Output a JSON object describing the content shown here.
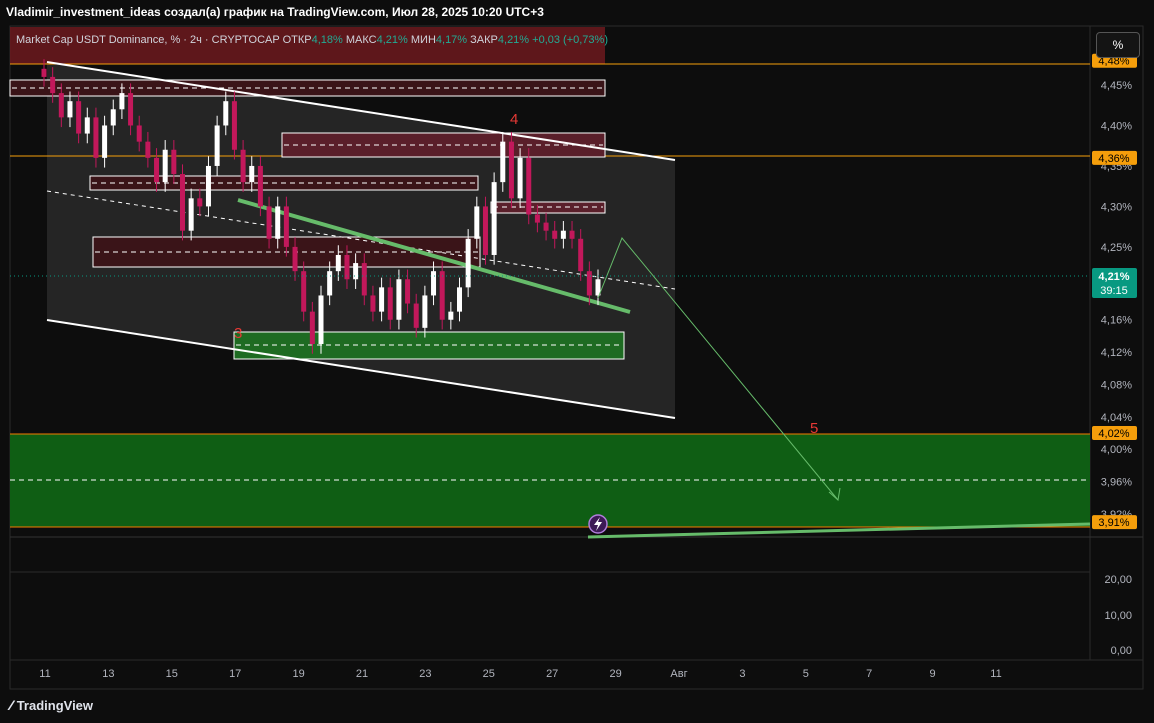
{
  "header": {
    "title": "Vladimir_investment_ideas создал(а) график на TradingView.com, Июл 28, 2025 10:20 UTC+3"
  },
  "legend": {
    "symbol": "Market Cap USDT Dominance, % · 2ч · CRYPTOCAP",
    "open_label": "ОТКР",
    "open": "4,18%",
    "high_label": "МАКС",
    "high": "4,21%",
    "low_label": "МИН",
    "low": "4,17%",
    "close_label": "ЗАКР",
    "close": "4,21%",
    "change": "+0,03 (+0,73%)"
  },
  "scale_button": "%",
  "footer": {
    "brand": "TradingView"
  },
  "colors": {
    "background": "#0d0d0d",
    "candle_up": "#ffffff",
    "candle_down": "#c2185b",
    "green_zone": "#0f5e14",
    "price_tag": "#f59e0b",
    "last_price_tag": "#089981",
    "trend_green": "#66bb6a"
  },
  "chart_data": {
    "type": "line",
    "price_axis": {
      "ticks": [
        "4,45%",
        "4,40%",
        "4,35%",
        "4,30%",
        "4,25%",
        "4,16%",
        "4,12%",
        "4,08%",
        "4,04%",
        "4,00%",
        "3,96%",
        "3,92%"
      ],
      "price_tags": [
        "4,48%",
        "4,36%",
        "4,02%",
        "3,91%"
      ],
      "last_price": "4,21%",
      "countdown": "39:15"
    },
    "lower_axis": {
      "ticks": [
        "20,00",
        "10,00",
        "0,00"
      ]
    },
    "time_axis": {
      "ticks": [
        "11",
        "13",
        "15",
        "17",
        "19",
        "21",
        "23",
        "25",
        "27",
        "29",
        "Авг",
        "3",
        "5",
        "7",
        "9",
        "11"
      ]
    },
    "wave_labels": [
      "3",
      "4",
      "5"
    ],
    "series": [
      {
        "values": [
          4.46,
          4.44,
          4.41,
          4.43,
          4.39,
          4.41,
          4.36,
          4.4,
          4.42,
          4.44,
          4.4,
          4.38,
          4.36,
          4.33,
          4.37,
          4.34,
          4.27,
          4.31,
          4.3,
          4.35,
          4.4,
          4.43,
          4.37,
          4.33,
          4.35,
          4.3,
          4.26,
          4.3,
          4.25,
          4.22,
          4.17,
          4.13,
          4.19,
          4.22,
          4.24,
          4.21,
          4.23,
          4.19,
          4.17,
          4.2,
          4.16,
          4.21,
          4.18,
          4.15,
          4.19,
          4.22,
          4.16,
          4.17,
          4.2,
          4.26,
          4.3,
          4.24,
          4.33,
          4.38,
          4.31,
          4.36,
          4.29,
          4.28,
          4.27,
          4.26,
          4.27,
          4.26,
          4.22,
          4.19,
          4.21
        ]
      }
    ]
  }
}
